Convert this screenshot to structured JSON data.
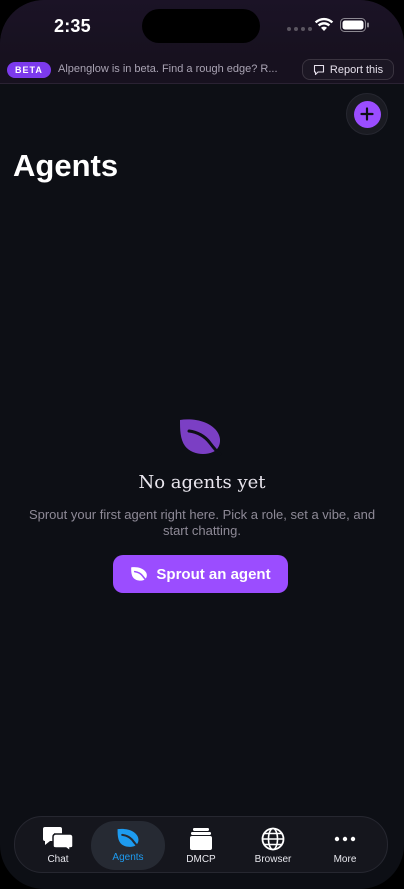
{
  "status_bar": {
    "time": "2:35"
  },
  "beta_banner": {
    "badge": "BETA",
    "message": "Alpenglow is in beta. Find a rough edge? R...",
    "report_label": "Report this"
  },
  "header": {
    "title": "Agents",
    "add_icon": "plus-icon"
  },
  "empty_state": {
    "icon": "leaf-icon",
    "title": "No agents yet",
    "subtitle": "Sprout your first agent right here. Pick a role, set a vibe, and start chatting.",
    "button_label": "Sprout an agent"
  },
  "tabs": [
    {
      "label": "Chat",
      "icon": "chat-bubbles-icon",
      "active": false
    },
    {
      "label": "Agents",
      "icon": "leaf-icon",
      "active": true
    },
    {
      "label": "DMCP",
      "icon": "stack-icon",
      "active": false
    },
    {
      "label": "Browser",
      "icon": "globe-icon",
      "active": false
    },
    {
      "label": "More",
      "icon": "ellipsis-icon",
      "active": false
    }
  ],
  "colors": {
    "accent": "#9b4dff",
    "active_tab": "#1d9bf0",
    "background": "#0d0f15"
  }
}
